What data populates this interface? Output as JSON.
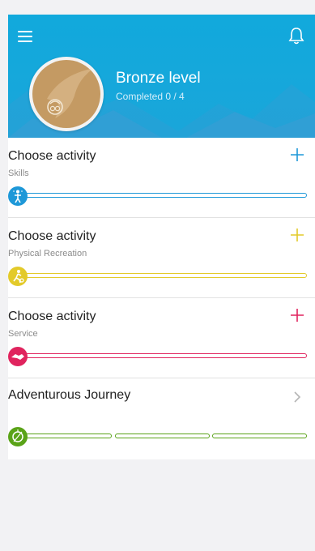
{
  "header": {
    "level_title": "Bronze level",
    "level_progress": "Completed 0 / 4",
    "bg_color": "#11a9dc"
  },
  "sections": [
    {
      "title": "Choose activity",
      "subtitle": "Skills",
      "action_icon": "plus-icon",
      "activity_icon": "skills-icon",
      "color": "#1e98d8",
      "progress": 0
    },
    {
      "title": "Choose activity",
      "subtitle": "Physical Recreation",
      "action_icon": "plus-icon",
      "activity_icon": "physical-recreation-icon",
      "color": "#e3ca2a",
      "progress": 0
    },
    {
      "title": "Choose activity",
      "subtitle": "Service",
      "action_icon": "plus-icon",
      "activity_icon": "service-handshake-icon",
      "color": "#e0245e",
      "progress": 0
    },
    {
      "title": "Adventurous Journey",
      "subtitle": "",
      "action_icon": "chevron-right-icon",
      "activity_icon": "compass-icon",
      "color": "#5aa318",
      "progress": 0,
      "segments": 3
    }
  ]
}
